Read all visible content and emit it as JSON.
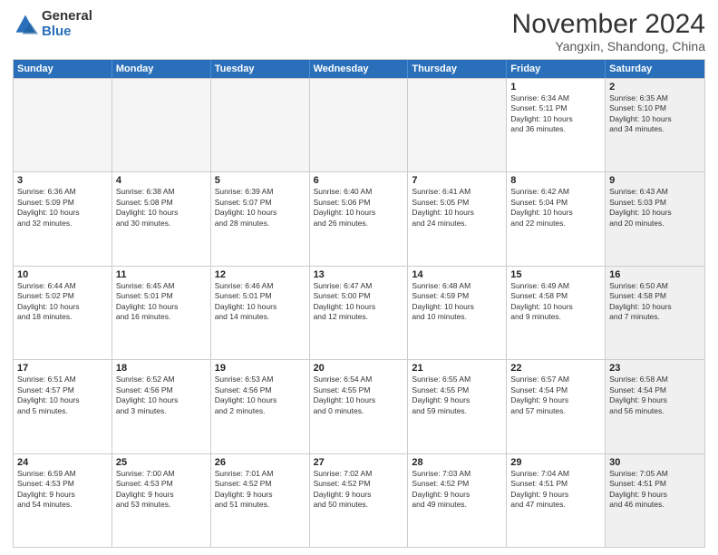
{
  "logo": {
    "general": "General",
    "blue": "Blue",
    "icon_color": "#2a6fba"
  },
  "header": {
    "month": "November 2024",
    "location": "Yangxin, Shandong, China"
  },
  "weekdays": [
    "Sunday",
    "Monday",
    "Tuesday",
    "Wednesday",
    "Thursday",
    "Friday",
    "Saturday"
  ],
  "rows": [
    {
      "cells": [
        {
          "day": "",
          "info": "",
          "empty": true
        },
        {
          "day": "",
          "info": "",
          "empty": true
        },
        {
          "day": "",
          "info": "",
          "empty": true
        },
        {
          "day": "",
          "info": "",
          "empty": true
        },
        {
          "day": "",
          "info": "",
          "empty": true
        },
        {
          "day": "1",
          "info": "Sunrise: 6:34 AM\nSunset: 5:11 PM\nDaylight: 10 hours\nand 36 minutes.",
          "empty": false
        },
        {
          "day": "2",
          "info": "Sunrise: 6:35 AM\nSunset: 5:10 PM\nDaylight: 10 hours\nand 34 minutes.",
          "empty": false,
          "shaded": true
        }
      ]
    },
    {
      "cells": [
        {
          "day": "3",
          "info": "Sunrise: 6:36 AM\nSunset: 5:09 PM\nDaylight: 10 hours\nand 32 minutes.",
          "empty": false
        },
        {
          "day": "4",
          "info": "Sunrise: 6:38 AM\nSunset: 5:08 PM\nDaylight: 10 hours\nand 30 minutes.",
          "empty": false
        },
        {
          "day": "5",
          "info": "Sunrise: 6:39 AM\nSunset: 5:07 PM\nDaylight: 10 hours\nand 28 minutes.",
          "empty": false
        },
        {
          "day": "6",
          "info": "Sunrise: 6:40 AM\nSunset: 5:06 PM\nDaylight: 10 hours\nand 26 minutes.",
          "empty": false
        },
        {
          "day": "7",
          "info": "Sunrise: 6:41 AM\nSunset: 5:05 PM\nDaylight: 10 hours\nand 24 minutes.",
          "empty": false
        },
        {
          "day": "8",
          "info": "Sunrise: 6:42 AM\nSunset: 5:04 PM\nDaylight: 10 hours\nand 22 minutes.",
          "empty": false
        },
        {
          "day": "9",
          "info": "Sunrise: 6:43 AM\nSunset: 5:03 PM\nDaylight: 10 hours\nand 20 minutes.",
          "empty": false,
          "shaded": true
        }
      ]
    },
    {
      "cells": [
        {
          "day": "10",
          "info": "Sunrise: 6:44 AM\nSunset: 5:02 PM\nDaylight: 10 hours\nand 18 minutes.",
          "empty": false
        },
        {
          "day": "11",
          "info": "Sunrise: 6:45 AM\nSunset: 5:01 PM\nDaylight: 10 hours\nand 16 minutes.",
          "empty": false
        },
        {
          "day": "12",
          "info": "Sunrise: 6:46 AM\nSunset: 5:01 PM\nDaylight: 10 hours\nand 14 minutes.",
          "empty": false
        },
        {
          "day": "13",
          "info": "Sunrise: 6:47 AM\nSunset: 5:00 PM\nDaylight: 10 hours\nand 12 minutes.",
          "empty": false
        },
        {
          "day": "14",
          "info": "Sunrise: 6:48 AM\nSunset: 4:59 PM\nDaylight: 10 hours\nand 10 minutes.",
          "empty": false
        },
        {
          "day": "15",
          "info": "Sunrise: 6:49 AM\nSunset: 4:58 PM\nDaylight: 10 hours\nand 9 minutes.",
          "empty": false
        },
        {
          "day": "16",
          "info": "Sunrise: 6:50 AM\nSunset: 4:58 PM\nDaylight: 10 hours\nand 7 minutes.",
          "empty": false,
          "shaded": true
        }
      ]
    },
    {
      "cells": [
        {
          "day": "17",
          "info": "Sunrise: 6:51 AM\nSunset: 4:57 PM\nDaylight: 10 hours\nand 5 minutes.",
          "empty": false
        },
        {
          "day": "18",
          "info": "Sunrise: 6:52 AM\nSunset: 4:56 PM\nDaylight: 10 hours\nand 3 minutes.",
          "empty": false
        },
        {
          "day": "19",
          "info": "Sunrise: 6:53 AM\nSunset: 4:56 PM\nDaylight: 10 hours\nand 2 minutes.",
          "empty": false
        },
        {
          "day": "20",
          "info": "Sunrise: 6:54 AM\nSunset: 4:55 PM\nDaylight: 10 hours\nand 0 minutes.",
          "empty": false
        },
        {
          "day": "21",
          "info": "Sunrise: 6:55 AM\nSunset: 4:55 PM\nDaylight: 9 hours\nand 59 minutes.",
          "empty": false
        },
        {
          "day": "22",
          "info": "Sunrise: 6:57 AM\nSunset: 4:54 PM\nDaylight: 9 hours\nand 57 minutes.",
          "empty": false
        },
        {
          "day": "23",
          "info": "Sunrise: 6:58 AM\nSunset: 4:54 PM\nDaylight: 9 hours\nand 56 minutes.",
          "empty": false,
          "shaded": true
        }
      ]
    },
    {
      "cells": [
        {
          "day": "24",
          "info": "Sunrise: 6:59 AM\nSunset: 4:53 PM\nDaylight: 9 hours\nand 54 minutes.",
          "empty": false
        },
        {
          "day": "25",
          "info": "Sunrise: 7:00 AM\nSunset: 4:53 PM\nDaylight: 9 hours\nand 53 minutes.",
          "empty": false
        },
        {
          "day": "26",
          "info": "Sunrise: 7:01 AM\nSunset: 4:52 PM\nDaylight: 9 hours\nand 51 minutes.",
          "empty": false
        },
        {
          "day": "27",
          "info": "Sunrise: 7:02 AM\nSunset: 4:52 PM\nDaylight: 9 hours\nand 50 minutes.",
          "empty": false
        },
        {
          "day": "28",
          "info": "Sunrise: 7:03 AM\nSunset: 4:52 PM\nDaylight: 9 hours\nand 49 minutes.",
          "empty": false
        },
        {
          "day": "29",
          "info": "Sunrise: 7:04 AM\nSunset: 4:51 PM\nDaylight: 9 hours\nand 47 minutes.",
          "empty": false
        },
        {
          "day": "30",
          "info": "Sunrise: 7:05 AM\nSunset: 4:51 PM\nDaylight: 9 hours\nand 46 minutes.",
          "empty": false,
          "shaded": true
        }
      ]
    }
  ]
}
